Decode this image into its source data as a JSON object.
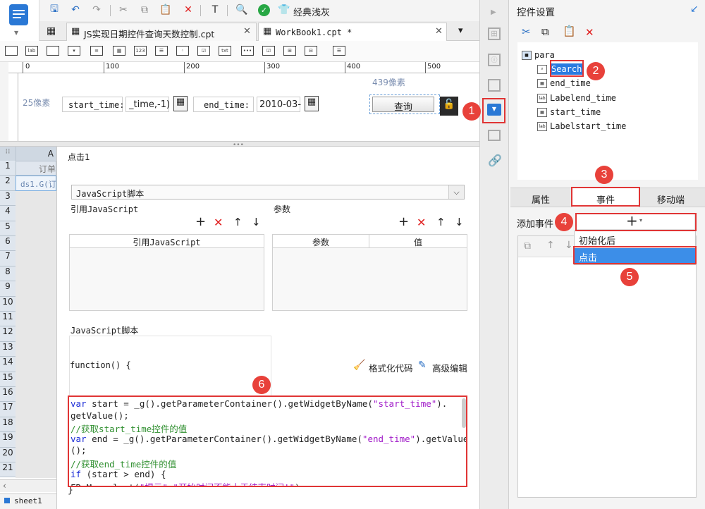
{
  "toolbar": {
    "theme_label": "经典浅灰"
  },
  "tabs": [
    {
      "label": "JS实现日期控件查询天数控制.cpt"
    },
    {
      "label": "WorkBook1.cpt *"
    }
  ],
  "ruler": {
    "ticks": [
      "0",
      "100",
      "200",
      "300",
      "400",
      "500"
    ]
  },
  "canvas": {
    "left_label": "25像素",
    "top_label": "439像素",
    "start_label": "start_time:",
    "start_value": "_time,-1)",
    "end_label": "end_time:",
    "end_value": "2010-03-",
    "query_button": "查询"
  },
  "sheet": {
    "col_header": "A",
    "rows": [
      "1",
      "2",
      "3",
      "4",
      "5",
      "6",
      "7",
      "8",
      "9",
      "10",
      "11",
      "12",
      "13",
      "14",
      "15",
      "16",
      "17",
      "18",
      "19",
      "20",
      "21"
    ],
    "cell_a1": "订单",
    "cell_a2": "ds1.G(订",
    "sheet_tab": "sheet1"
  },
  "event_panel": {
    "title": "点击1",
    "script_type": "JavaScript脚本",
    "ref_js_label": "引用JavaScript",
    "params_label": "参数",
    "ref_js_col": "引用JavaScript",
    "param_col": "参数",
    "value_col": "值",
    "script_label": "JavaScript脚本",
    "function_sig": "function() {",
    "format_code": "格式化代码",
    "advanced_edit": "高级编辑",
    "closing_brace": "}",
    "code": [
      {
        "parts": [
          {
            "c": "kw",
            "t": "var"
          },
          {
            "c": "",
            "t": " start = _g().getParameterContainer().getWidgetByName("
          },
          {
            "c": "str",
            "t": "\"start_time\""
          },
          {
            "c": "",
            "t": ")."
          }
        ]
      },
      {
        "parts": [
          {
            "c": "",
            "t": "getValue();"
          }
        ]
      },
      {
        "parts": [
          {
            "c": "cm",
            "t": "//获取start_time控件的值"
          }
        ]
      },
      {
        "parts": [
          {
            "c": "kw",
            "t": "var"
          },
          {
            "c": "",
            "t": " end = _g().getParameterContainer().getWidgetByName("
          },
          {
            "c": "str",
            "t": "\"end_time\""
          },
          {
            "c": "",
            "t": ").getValue"
          }
        ]
      },
      {
        "parts": [
          {
            "c": "",
            "t": "();"
          }
        ]
      },
      {
        "parts": [
          {
            "c": "cm",
            "t": "//获取end_time控件的值"
          }
        ]
      },
      {
        "parts": [
          {
            "c": "kw",
            "t": "if"
          },
          {
            "c": "",
            "t": " (start > end) {"
          }
        ]
      },
      {
        "parts": [
          {
            "c": "",
            "t": "    FR.Msg.alert("
          },
          {
            "c": "str",
            "t": "\"提示\",\"开始时间不能大于结束时间!\""
          },
          {
            "c": "",
            "t": ");"
          }
        ]
      }
    ]
  },
  "right_panel": {
    "title": "控件设置",
    "tree": [
      {
        "label": "para",
        "icon": "form-icon"
      },
      {
        "label": "Search",
        "icon": "search-button-icon"
      },
      {
        "label": "end_time",
        "icon": "date-widget-icon"
      },
      {
        "label": "Labelend_time",
        "icon": "label-widget-icon"
      },
      {
        "label": "start_time",
        "icon": "date-widget-icon"
      },
      {
        "label": "Labelstart_time",
        "icon": "label-widget-icon"
      }
    ],
    "tabs": [
      "属性",
      "事件",
      "移动端"
    ],
    "add_event_label": "添加事件",
    "add_symbol": "+",
    "menu": [
      "初始化后",
      "点击"
    ]
  },
  "badges": [
    "1",
    "2",
    "3",
    "4",
    "5",
    "6"
  ],
  "colors": {
    "highlight": "#e03535",
    "selection": "#3c8ee8",
    "badge": "#e8413a"
  }
}
